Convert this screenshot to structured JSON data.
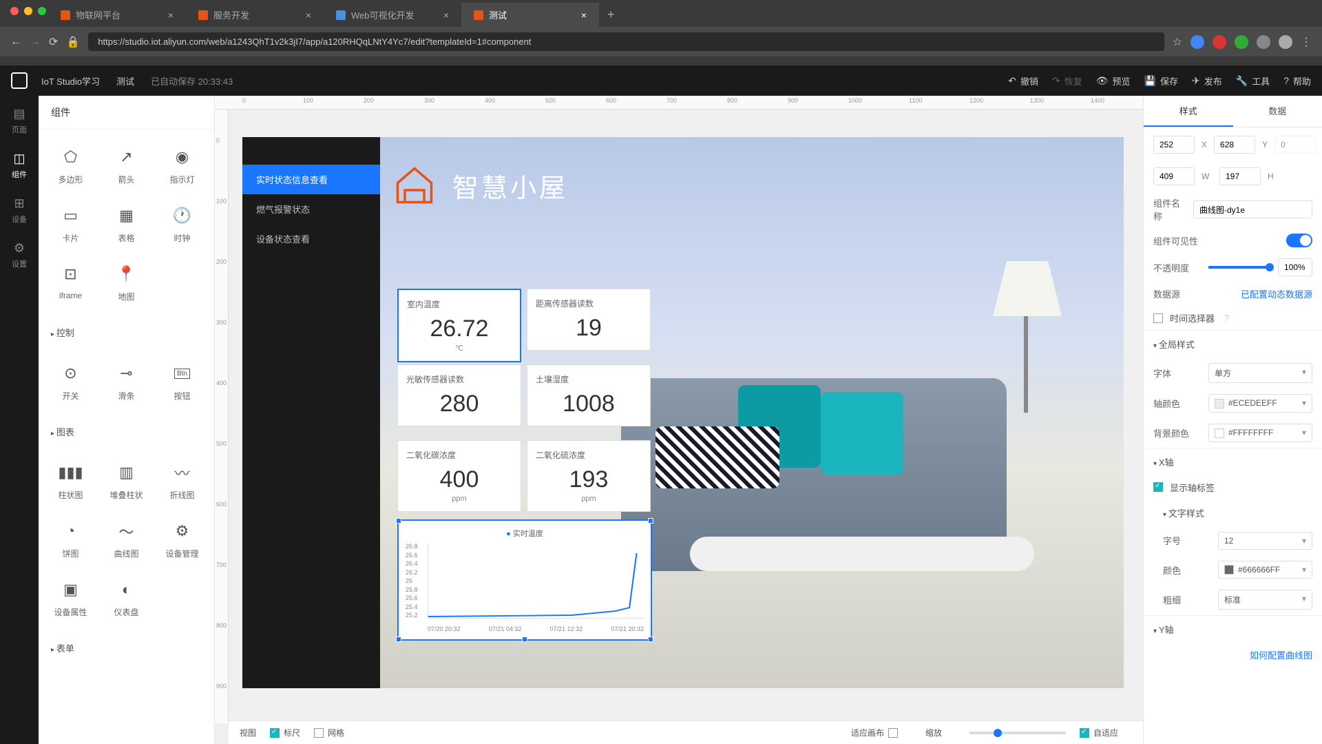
{
  "browser": {
    "tabs": [
      {
        "label": "物联网平台"
      },
      {
        "label": "服务开发"
      },
      {
        "label": "Web可视化开发"
      },
      {
        "label": "测试"
      }
    ],
    "url": "https://studio.iot.aliyun.com/web/a1243QhT1v2k3jI7/app/a120RHQqLNtY4Yc7/edit?templateId=1#component"
  },
  "toolbar": {
    "title": "IoT Studio学习",
    "page": "测试",
    "saved": "已自动保存 20:33:43",
    "undo": "撤销",
    "redo": "恢复",
    "preview": "预览",
    "save": "保存",
    "publish": "发布",
    "tools": "工具",
    "help": "帮助"
  },
  "leftRail": {
    "page": "页面",
    "components": "组件",
    "devices": "设备",
    "settings": "设置"
  },
  "compPanel": {
    "title": "组件",
    "items": {
      "polygon": "多边形",
      "arrow": "箭头",
      "indicator": "指示灯",
      "card": "卡片",
      "table": "表格",
      "clock": "时钟",
      "iframe": "iframe",
      "map": "地图",
      "switch": "开关",
      "slider": "滑条",
      "button": "按钮",
      "bar": "柱状图",
      "stackbar": "堆叠柱状",
      "line": "折线图",
      "pie": "饼图",
      "curve": "曲线图",
      "devmgmt": "设备管理",
      "devattr": "设备属性",
      "gauge": "仪表盘"
    },
    "sections": {
      "control": "控制",
      "chart": "图表",
      "table": "表单"
    }
  },
  "canvas": {
    "menu": {
      "realtime": "实时状态信息查看",
      "gas": "燃气报警状态",
      "device": "设备状态查看"
    },
    "header": "智慧小屋",
    "cards": {
      "temp": {
        "label": "室内温度",
        "value": "26.72",
        "unit": "℃"
      },
      "dist": {
        "label": "距离传感器读数",
        "value": "19"
      },
      "light": {
        "label": "光敏传感器读数",
        "value": "280"
      },
      "soil": {
        "label": "土壤湿度",
        "value": "1008"
      },
      "co2": {
        "label": "二氧化碳浓度",
        "value": "400",
        "unit": "ppm"
      },
      "so2": {
        "label": "二氧化硫浓度",
        "value": "193",
        "unit": "ppm"
      }
    }
  },
  "chart_data": {
    "type": "line",
    "legend": "实时温度",
    "ylabels": [
      "26.8",
      "26.6",
      "26.4",
      "26.2",
      "26",
      "25.8",
      "25.6",
      "25.4",
      "25.2"
    ],
    "xlabels": [
      "07/20 20:32",
      "07/21 04:32",
      "07/21 12:32",
      "07/21 20:32"
    ],
    "series": [
      {
        "name": "实时温度",
        "values": [
          25.2,
          25.2,
          25.3,
          26.7
        ]
      }
    ],
    "ylim": [
      25.2,
      26.8
    ]
  },
  "bottomBar": {
    "view": "视图",
    "ruler": "标尺",
    "grid": "网格",
    "fit": "适应画布",
    "zoom": "缩放",
    "auto": "自适应"
  },
  "props": {
    "tabs": {
      "style": "样式",
      "data": "数据"
    },
    "x": "252",
    "y": "628",
    "w": "409",
    "h": "197",
    "angle": "0",
    "name_label": "组件名称",
    "name": "曲线图-dy1e",
    "visible_label": "组件可见性",
    "opacity_label": "不透明度",
    "opacity": "100%",
    "datasource_label": "数据源",
    "datasource_link": "已配置动态数据源",
    "timepicker_label": "时间选择器",
    "global_section": "全局样式",
    "font_label": "字体",
    "font": "单方",
    "axis_color_label": "轴颜色",
    "axis_color": "#ECEDEEFF",
    "bg_color_label": "背景颜色",
    "bg_color": "#FFFFFFFF",
    "x_axis_section": "X轴",
    "show_axis_label": "显示轴标签",
    "text_style_section": "文字样式",
    "font_size_label": "字号",
    "font_size": "12",
    "color_label": "颜色",
    "color": "#666666FF",
    "weight_label": "粗细",
    "weight": "标准",
    "y_axis_section": "Y轴",
    "help_link": "如何配置曲线图"
  },
  "rulerH": [
    "0",
    "100",
    "200",
    "300",
    "400",
    "500",
    "600",
    "700",
    "800",
    "900",
    "1000",
    "1100",
    "1200",
    "1300",
    "1400"
  ],
  "rulerV": [
    "0",
    "100",
    "200",
    "300",
    "400",
    "500",
    "600",
    "700",
    "800",
    "900"
  ]
}
